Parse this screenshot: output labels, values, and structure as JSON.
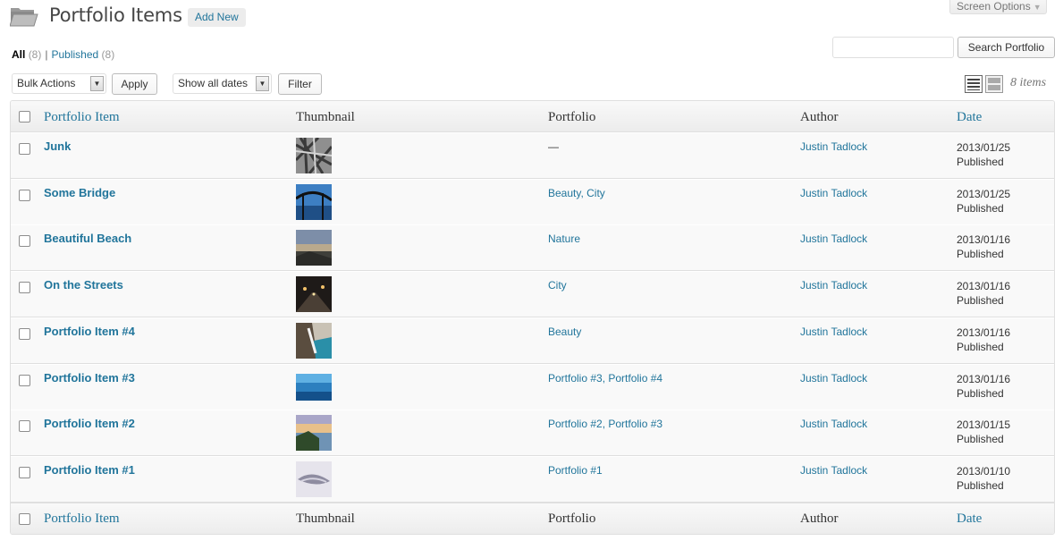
{
  "screen_options": {
    "label": "Screen Options"
  },
  "header": {
    "title": "Portfolio Items",
    "add_new": "Add New"
  },
  "subsubsub": {
    "all_label": "All",
    "all_count": "(8)",
    "separator": "|",
    "published_label": "Published",
    "published_count": "(8)"
  },
  "search": {
    "value": "",
    "button": "Search Portfolio"
  },
  "tablenav": {
    "bulk_actions": "Bulk Actions",
    "apply": "Apply",
    "dates": "Show all dates",
    "filter": "Filter",
    "items_count": "8 items"
  },
  "columns": {
    "title": "Portfolio Item",
    "thumbnail": "Thumbnail",
    "portfolio": "Portfolio",
    "author": "Author",
    "date": "Date"
  },
  "rows": [
    {
      "title": "Junk",
      "portfolio": "—",
      "author": "Justin Tadlock",
      "date": "2013/01/25",
      "status": "Published"
    },
    {
      "title": "Some Bridge",
      "portfolio": "Beauty, City",
      "author": "Justin Tadlock",
      "date": "2013/01/25",
      "status": "Published"
    },
    {
      "title": "Beautiful Beach",
      "portfolio": "Nature",
      "author": "Justin Tadlock",
      "date": "2013/01/16",
      "status": "Published"
    },
    {
      "title": "On the Streets",
      "portfolio": "City",
      "author": "Justin Tadlock",
      "date": "2013/01/16",
      "status": "Published"
    },
    {
      "title": "Portfolio Item #4",
      "portfolio": "Beauty",
      "author": "Justin Tadlock",
      "date": "2013/01/16",
      "status": "Published"
    },
    {
      "title": "Portfolio Item #3",
      "portfolio": "Portfolio #3, Portfolio #4",
      "author": "Justin Tadlock",
      "date": "2013/01/16",
      "status": "Published"
    },
    {
      "title": "Portfolio Item #2",
      "portfolio": "Portfolio #2, Portfolio #3",
      "author": "Justin Tadlock",
      "date": "2013/01/15",
      "status": "Published"
    },
    {
      "title": "Portfolio Item #1",
      "portfolio": "Portfolio #1",
      "author": "Justin Tadlock",
      "date": "2013/01/10",
      "status": "Published"
    }
  ],
  "colors": {
    "link": "#21759b",
    "text": "#333333",
    "muted": "#999999",
    "border": "#dfdfdf"
  }
}
